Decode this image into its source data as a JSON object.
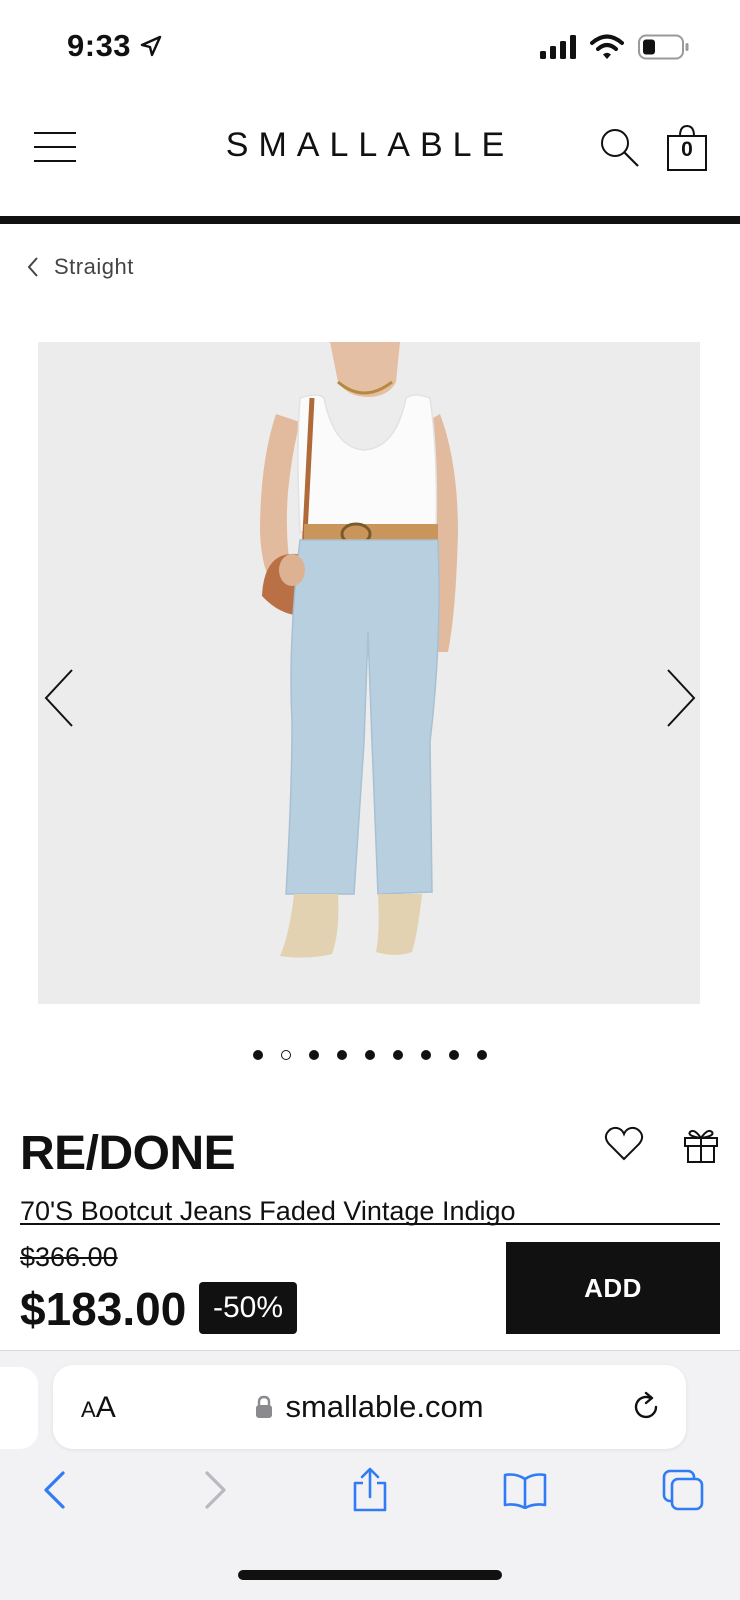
{
  "status_bar": {
    "time": "9:33"
  },
  "header": {
    "logo": "SMALLABLE",
    "cart_count": "0"
  },
  "breadcrumb": {
    "label": "Straight"
  },
  "carousel": {
    "total_slides": 9,
    "active_index": 1
  },
  "product": {
    "brand": "RE/DONE",
    "title": "70'S Bootcut Jeans Faded Vintage Indigo",
    "old_price": "$366.00",
    "price": "$183.00",
    "discount": "-50%",
    "add_label": "ADD"
  },
  "browser": {
    "text_size_small": "A",
    "text_size_large": "A",
    "url": "smallable.com"
  },
  "colors": {
    "ink": "#111111",
    "safari_blue": "#2f7cf6",
    "image_bg": "#ededed"
  }
}
